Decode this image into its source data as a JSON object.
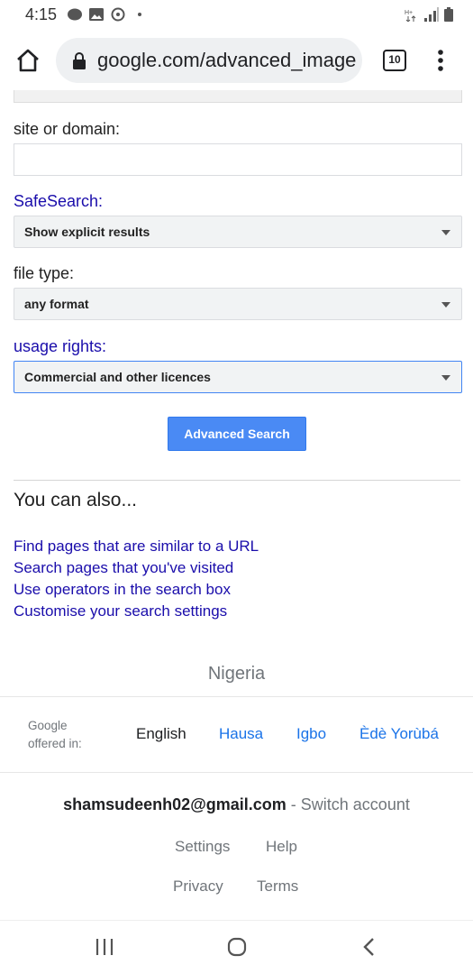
{
  "status_bar": {
    "time": "4:15"
  },
  "browser": {
    "url": "google.com/advanced_image",
    "tab_count": "10"
  },
  "form": {
    "site_label": "site or domain:",
    "site_value": "",
    "safesearch_label": "SafeSearch:",
    "safesearch_value": "Show explicit results",
    "filetype_label": "file type:",
    "filetype_value": "any format",
    "rights_label": "usage rights:",
    "rights_value": "Commercial and other licences",
    "submit_label": "Advanced Search"
  },
  "also": {
    "title": "You can also...",
    "links": [
      "Find pages that are similar to a URL",
      "Search pages that you've visited",
      "Use operators in the search box",
      "Customise your search settings"
    ]
  },
  "footer": {
    "country": "Nigeria",
    "offered_line1": "Google",
    "offered_line2": "offered in:",
    "languages": [
      "English",
      "Hausa",
      "Igbo",
      "Èdè Yorùbá"
    ],
    "email": "shamsudeenh02@gmail.com",
    "switch_account": " - Switch account",
    "settings": "Settings",
    "help": "Help",
    "privacy": "Privacy",
    "terms": "Terms"
  },
  "colors": {
    "link": "#1a0dab",
    "button": "#4a8af4",
    "lang_link": "#1a73e8"
  }
}
